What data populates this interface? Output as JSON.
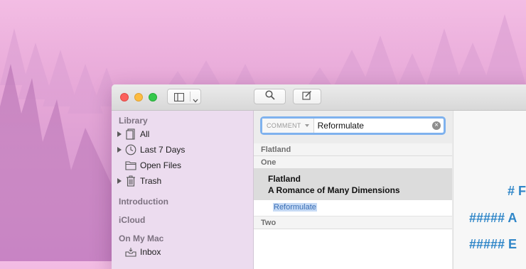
{
  "sidebar": {
    "library_title": "Library",
    "items": [
      {
        "label": "All",
        "icon": "notebook-icon"
      },
      {
        "label": "Last 7 Days",
        "icon": "clock-icon"
      },
      {
        "label": "Open Files",
        "icon": "folder-icon"
      },
      {
        "label": "Trash",
        "icon": "trash-icon"
      }
    ],
    "introduction": "Introduction",
    "icloud": "iCloud",
    "on_my_mac": "On My Mac",
    "inbox": "Inbox"
  },
  "search": {
    "scope_label": "COMMENT",
    "value": "Reformulate"
  },
  "list": {
    "group_flatland": "Flatland",
    "group_one": "One",
    "note_title": "Flatland",
    "note_subtitle": "A Romance of Many Dimensions",
    "tag": "Reformulate",
    "group_two": "Two"
  },
  "editor": {
    "line1": "# F",
    "line2": "##### A",
    "line3": "##### E"
  },
  "colors": {
    "accent": "#2f86c8",
    "sidebar_bg": "#ecdcef",
    "selection": "#dcdcdc"
  }
}
